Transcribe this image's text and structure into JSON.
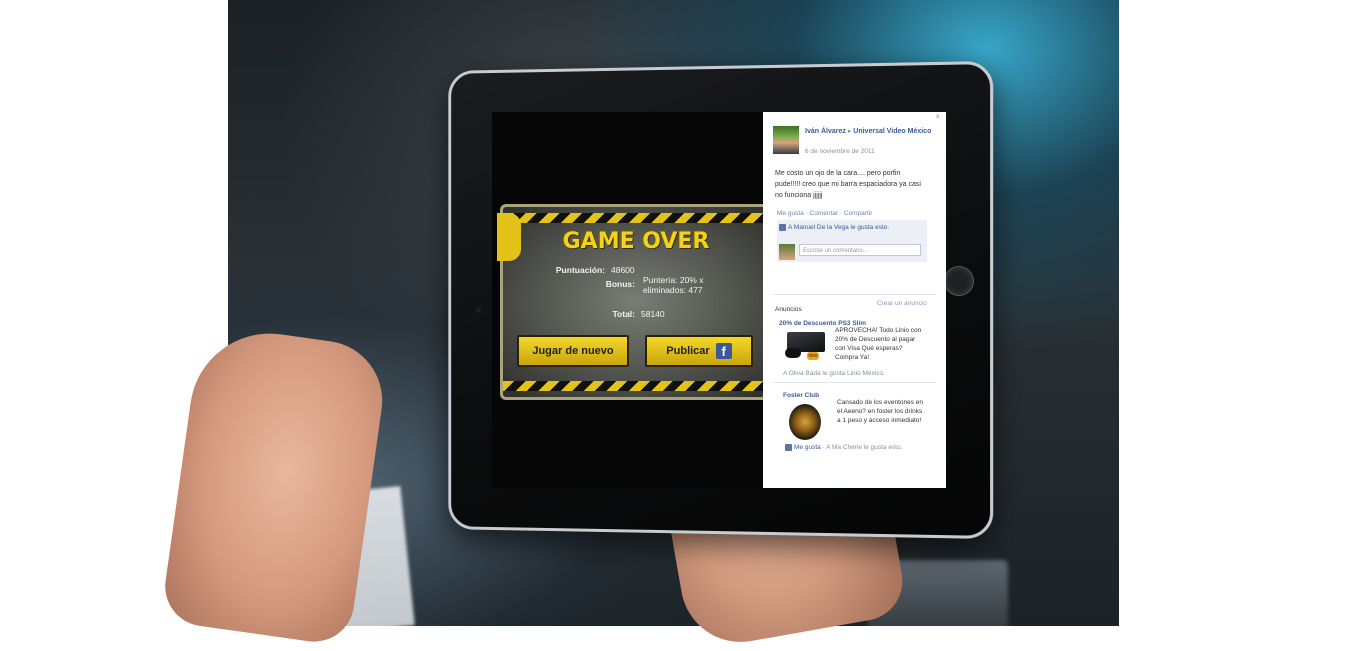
{
  "game": {
    "title": "GAME OVER",
    "score_label": "Puntuación:",
    "score_value": "48600",
    "bonus_label": "Bonus:",
    "bonus_value": "Puntería: 20%  x eliminados: 477",
    "total_label": "Total:",
    "total_value": "58140",
    "play_again_label": "Jugar de nuevo",
    "publish_label": "Publicar",
    "fb_logo": "f"
  },
  "facebook": {
    "close": "×",
    "author": "Iván Álvarez",
    "arrow": "▸",
    "page": "Universal Video México",
    "date": "6 de noviembre de 2011",
    "post_text": "Me costo un ojo de la cara.... pero porfin pude!!!!! creo que mi barra espaciadora ya casi no funciona jjjjjj",
    "actions": "Me gusta · Comentar · Compartir",
    "likes": "A Manuel De la Vega le gusta esto.",
    "comment_placeholder": "Escribe un comentario...",
    "ads_label": "Anuncios",
    "create_ad": "Crear un anuncio",
    "ad1_title": "20% de Descuento PS3 Slim",
    "ad1_text": "APROVECHA! Todo Linio con 20% de Descuento al pagar con Visa Qué esperas? Compra Ya!",
    "ad1_badge": "linio",
    "ad1_social": "A Oliva Bada le gusta Linio México.",
    "ad2_title": "Foster Club",
    "ad2_text": "Cansado de los eventones en el Aeeno? en foster los drinks a 1 peso y acceso inmediato!",
    "ad2_like": "Me gusta",
    "ad2_social": "· A Ma Cherie le gusta esto."
  }
}
